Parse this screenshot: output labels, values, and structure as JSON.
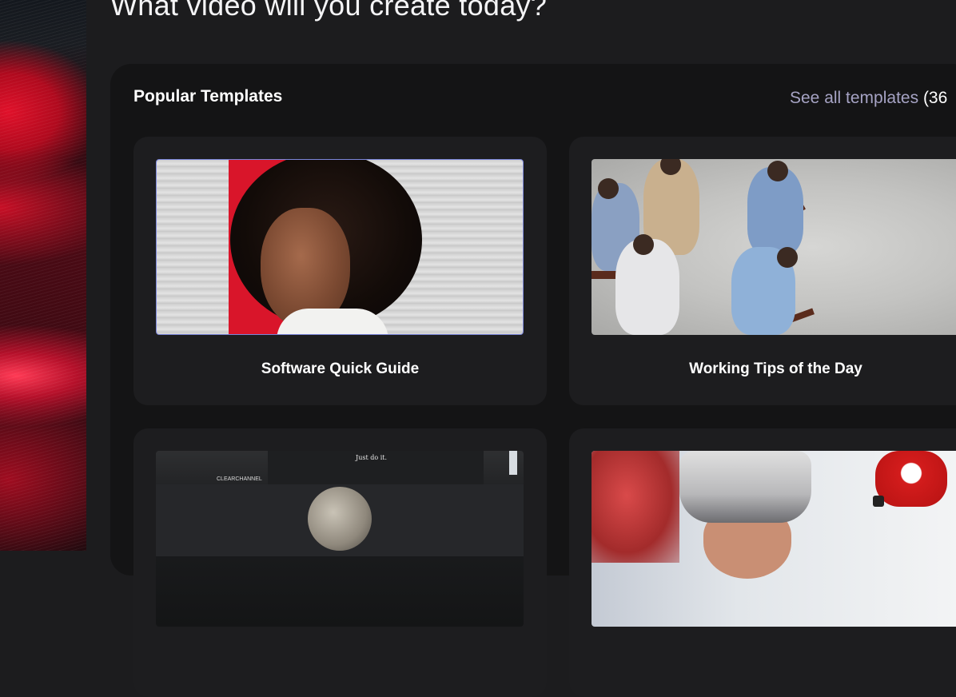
{
  "headline": "What video will you create today?",
  "section": {
    "title": "Popular Templates",
    "see_all_label": "See all templates",
    "see_all_count": "(36"
  },
  "templates": [
    {
      "label": "Software Quick Guide"
    },
    {
      "label": "Working Tips of the Day"
    },
    {
      "label": ""
    },
    {
      "label": ""
    }
  ],
  "thumbnail_text": {
    "billboard_slogan": "Just do it.",
    "billboard_owner": "CLEARCHANNEL"
  },
  "colors": {
    "background": "#1c1c1e",
    "panel": "#141415",
    "card": "#1d1d1f",
    "link": "#a6a3c4",
    "accent_red": "#d9152a"
  }
}
